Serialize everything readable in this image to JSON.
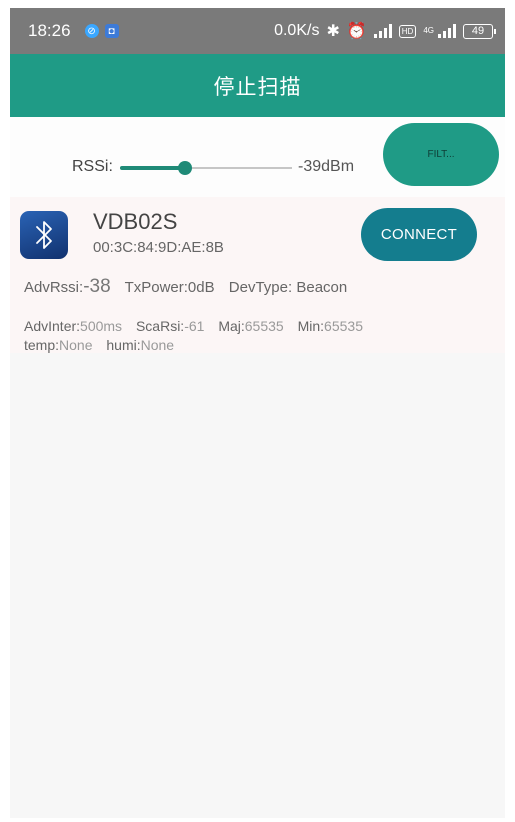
{
  "status_bar": {
    "time": "18:26",
    "speed": "0.0K/s",
    "network": "4G",
    "battery": "49"
  },
  "app_bar": {
    "title": "停止扫描",
    "color": "#1f9b86"
  },
  "rssi_filter": {
    "label": "RSSi:",
    "value_text": "-39dBm",
    "slider_fraction": 0.38,
    "filter_button_label": "FILT..."
  },
  "devices": [
    {
      "name": "VDB02S",
      "mac": "00:3C:84:9D:AE:8B",
      "connect_label": "CONNECT",
      "adv_rssi_label": "AdvRssi:",
      "adv_rssi_value": "-38",
      "tx_power_label": "TxPower:",
      "tx_power_value": "0dB",
      "dev_type_label": "DevType:",
      "dev_type_value": "Beacon",
      "adv_inter_label": "AdvInter:",
      "adv_inter_value": "500ms",
      "sca_rsi_label": "ScaRsi:",
      "sca_rsi_value": "-61",
      "maj_label": "Maj:",
      "maj_value": "65535",
      "min_label": "Min:",
      "min_value": "65535",
      "temp_label": "temp:",
      "temp_value": "None",
      "humi_label": "humi:",
      "humi_value": "None",
      "icon": "bluetooth-icon"
    }
  ]
}
